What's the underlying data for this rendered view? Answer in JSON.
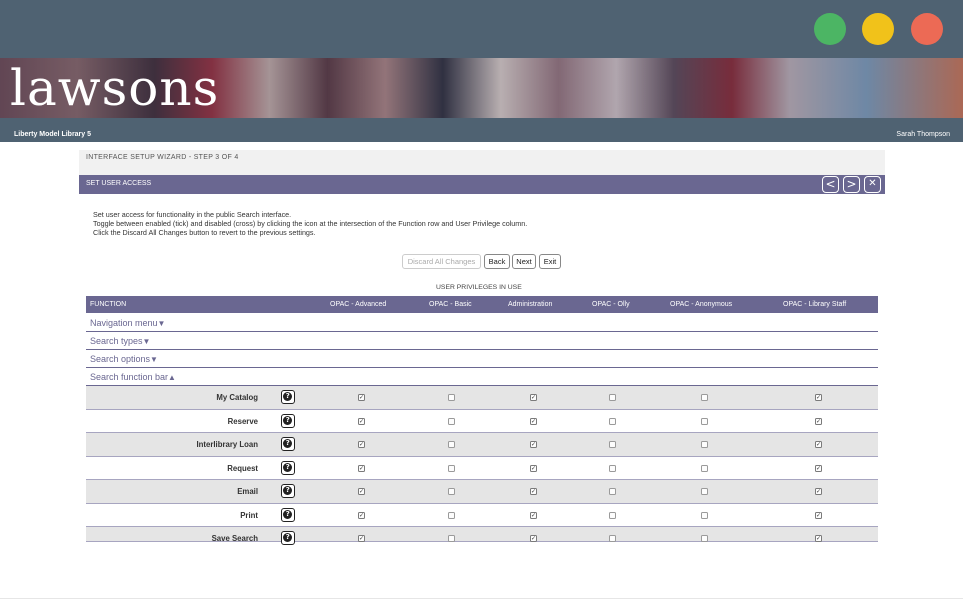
{
  "window": {
    "controls": [
      "green",
      "yellow",
      "red"
    ]
  },
  "header": {
    "logo": "lawsons",
    "library_name": "Liberty Model Library 5",
    "user_name": "Sarah Thompson"
  },
  "wizard": {
    "step": "INTERFACE SETUP WIZARD - STEP 3 OF 4",
    "section_title": "SET USER ACCESS",
    "nav": {
      "prev": "<",
      "next": ">",
      "close": "✕"
    },
    "instructions": [
      "Set user access for functionality in the public Search interface.",
      "Toggle between enabled (tick) and disabled (cross) by clicking the icon at the intersection of the Function row and User Privilege column.",
      "Click the Discard All Changes button to revert to the previous settings."
    ],
    "buttons": {
      "discard": "Discard All Changes",
      "back": "Back",
      "next": "Next",
      "exit": "Exit"
    }
  },
  "table": {
    "privileges_title": "USER PRIVILEGES IN USE",
    "function_header": "FUNCTION",
    "columns": [
      "OPAC - Advanced",
      "OPAC - Basic",
      "Administration",
      "OPAC - Olly",
      "OPAC - Anonymous",
      "OPAC - Library Staff"
    ],
    "groups": [
      {
        "label": "Navigation menu",
        "arrow": "▼"
      },
      {
        "label": "Search types",
        "arrow": "▼"
      },
      {
        "label": "Search options",
        "arrow": "▼"
      },
      {
        "label": "Search function bar",
        "arrow": "▲"
      }
    ],
    "help_icon": "?",
    "rows": [
      {
        "name": "My Catalog",
        "values": [
          true,
          false,
          true,
          false,
          false,
          true
        ]
      },
      {
        "name": "Reserve",
        "values": [
          true,
          false,
          true,
          false,
          false,
          true
        ]
      },
      {
        "name": "Interlibrary Loan",
        "values": [
          true,
          false,
          true,
          false,
          false,
          true
        ]
      },
      {
        "name": "Request",
        "values": [
          true,
          false,
          true,
          false,
          false,
          true
        ]
      },
      {
        "name": "Email",
        "values": [
          true,
          false,
          true,
          false,
          false,
          true
        ]
      },
      {
        "name": "Print",
        "values": [
          true,
          false,
          true,
          false,
          false,
          true
        ]
      },
      {
        "name": "Save Search",
        "values": [
          true,
          false,
          true,
          false,
          false,
          true
        ]
      }
    ],
    "tick": "✓"
  }
}
